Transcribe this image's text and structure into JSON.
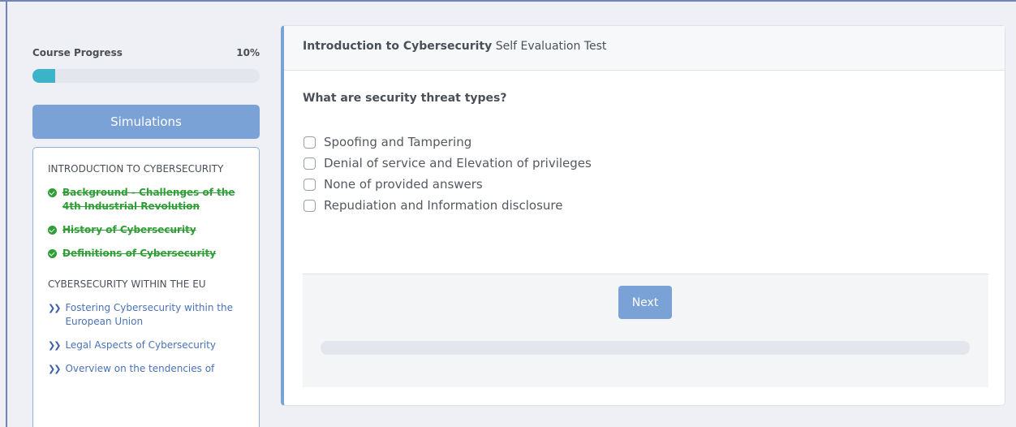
{
  "sidebar": {
    "progress_label": "Course Progress",
    "progress_value_text": "10%",
    "progress_fraction": 0.1,
    "simulations_label": "Simulations",
    "section_1": "INTRODUCTION TO CYBERSECURITY",
    "completed_items": [
      "Background - Challenges of the 4th Industrial Revolution",
      "History of Cybersecurity",
      "Definitions of Cybersecurity"
    ],
    "section_2": "CYBERSECURITY WITHIN THE EU",
    "pending_items": [
      "Fostering Cybersecurity within the European Union",
      "Legal Aspects of Cybersecurity",
      "Overview on the tendencies of"
    ]
  },
  "card": {
    "title_bold": "Introduction to Cybersecurity",
    "title_rest": " Self Evaluation Test",
    "question": "What are security threat types?",
    "options": [
      "Spoofing and Tampering",
      "Denial of service and Elevation of privileges",
      "None of provided answers",
      "Repudiation and Information disclosure"
    ],
    "next_label": "Next",
    "quiz_progress_fraction": 0
  },
  "colors": {
    "accent": "#7aa2d6",
    "progress": "#3bb3c9",
    "done": "#2f9e36",
    "link": "#4a72b8"
  },
  "icons": {
    "done": "check-circle-icon",
    "pending": "double-chevron-right-icon"
  }
}
